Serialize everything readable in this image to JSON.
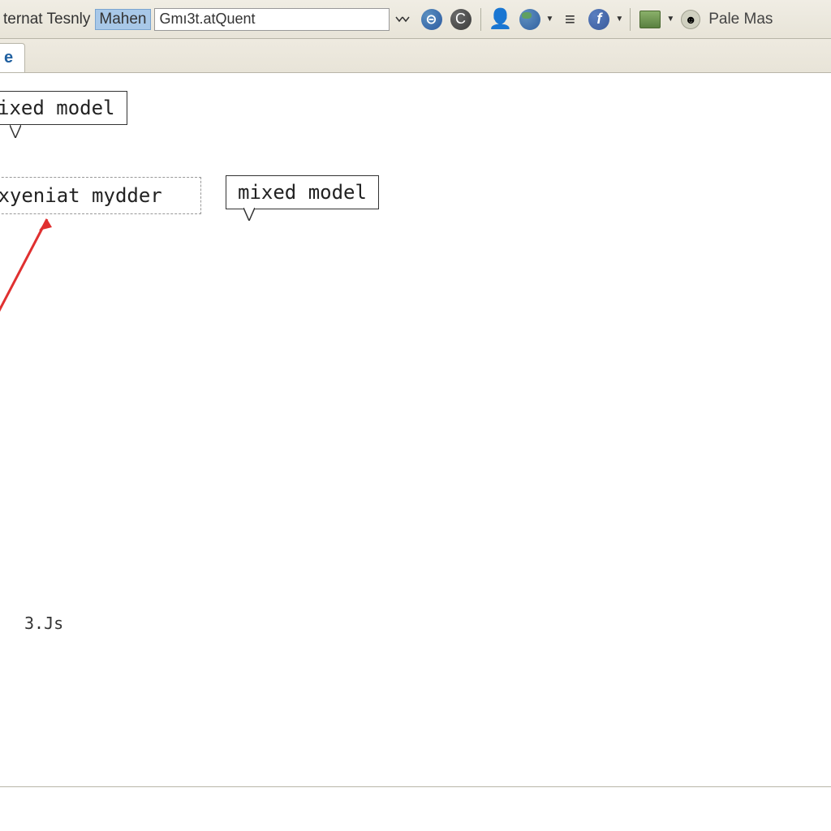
{
  "toolbar": {
    "prefix_text": "ternat Tesnly",
    "highlighted": "Mahen",
    "url_value": "Gmı3t.atQuent",
    "browser_name": "Pale Mas"
  },
  "tab": {
    "label": "e"
  },
  "content": {
    "tooltip1": "ixed model",
    "input_text": "nxyeniat mydder",
    "tooltip2": "mixed model",
    "footer": "3.Js"
  }
}
